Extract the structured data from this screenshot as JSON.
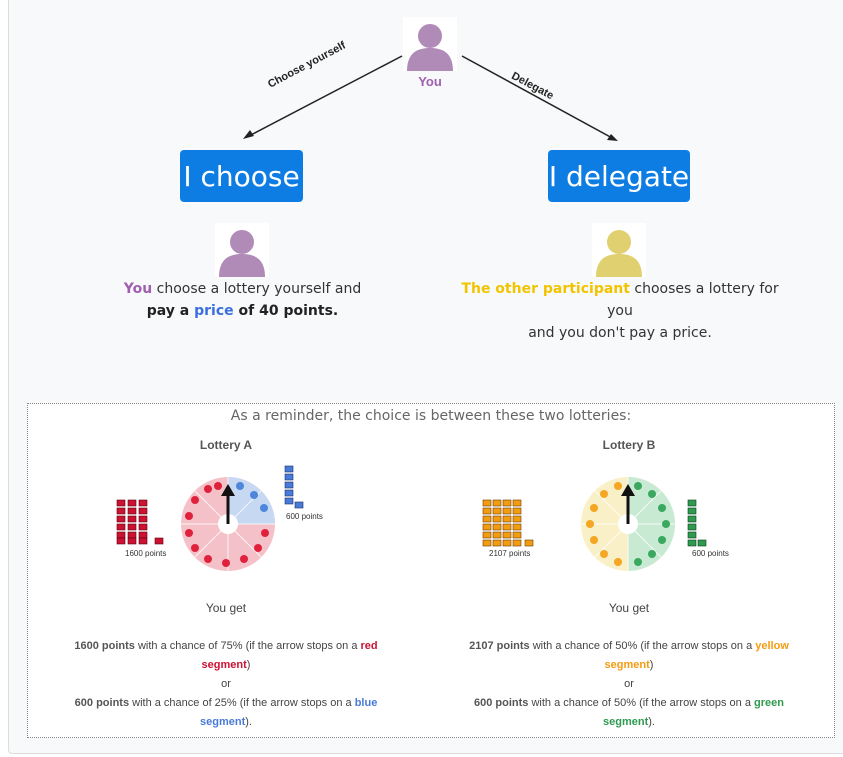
{
  "top": {
    "you_label": "You",
    "choose_yourself_label": "Choose yourself",
    "delegate_label": "Delegate",
    "choose_button": "I choose",
    "delegate_button": "I delegate"
  },
  "choose_desc": {
    "you": "You",
    "line1_rest": " choose a lottery yourself and",
    "pay_a": "pay a ",
    "price": "price",
    "of_points": " of 40 points."
  },
  "delegate_desc": {
    "other": "The other participant",
    "line1_rest": " chooses a lottery for you",
    "line2": "and you don't pay a price."
  },
  "reminder": "As a reminder, the choice is between these two lotteries:",
  "lottery_a": {
    "title": "Lottery A",
    "high_points_label": "1600 points",
    "low_points_label": "600 points",
    "you_get": "You get",
    "o1_points": "1600 points",
    "o1_text": " with a chance of 75% (if the arrow stops on a ",
    "o1_color": "red",
    "o1_seg": "segment",
    "o1_end": ")",
    "or": "or",
    "o2_points": "600 points",
    "o2_text": " with a chance of 25% (if the arrow stops on a ",
    "o2_color": "blue",
    "o2_seg": "segment",
    "o2_end": ")."
  },
  "lottery_b": {
    "title": "Lottery B",
    "high_points_label": "2107 points",
    "low_points_label": "600 points",
    "you_get": "You get",
    "o1_points": "2107 points",
    "o1_text": " with a chance of 50% (if the arrow stops on a ",
    "o1_color": "yellow",
    "o1_seg": "segment",
    "o1_end": ")",
    "or": "or",
    "o2_points": "600 points",
    "o2_text": " with a chance of 50% (if the arrow stops on a ",
    "o2_color": "green",
    "o2_seg": "segment",
    "o2_end": ")."
  },
  "colors": {
    "you_purple": "#a15fb0",
    "other_yellow": "#e0d070",
    "button_blue": "#0d7de3",
    "red": "#cc1133",
    "blue": "#4a7ad8",
    "orange": "#f39c12",
    "green": "#2e9a4f"
  }
}
